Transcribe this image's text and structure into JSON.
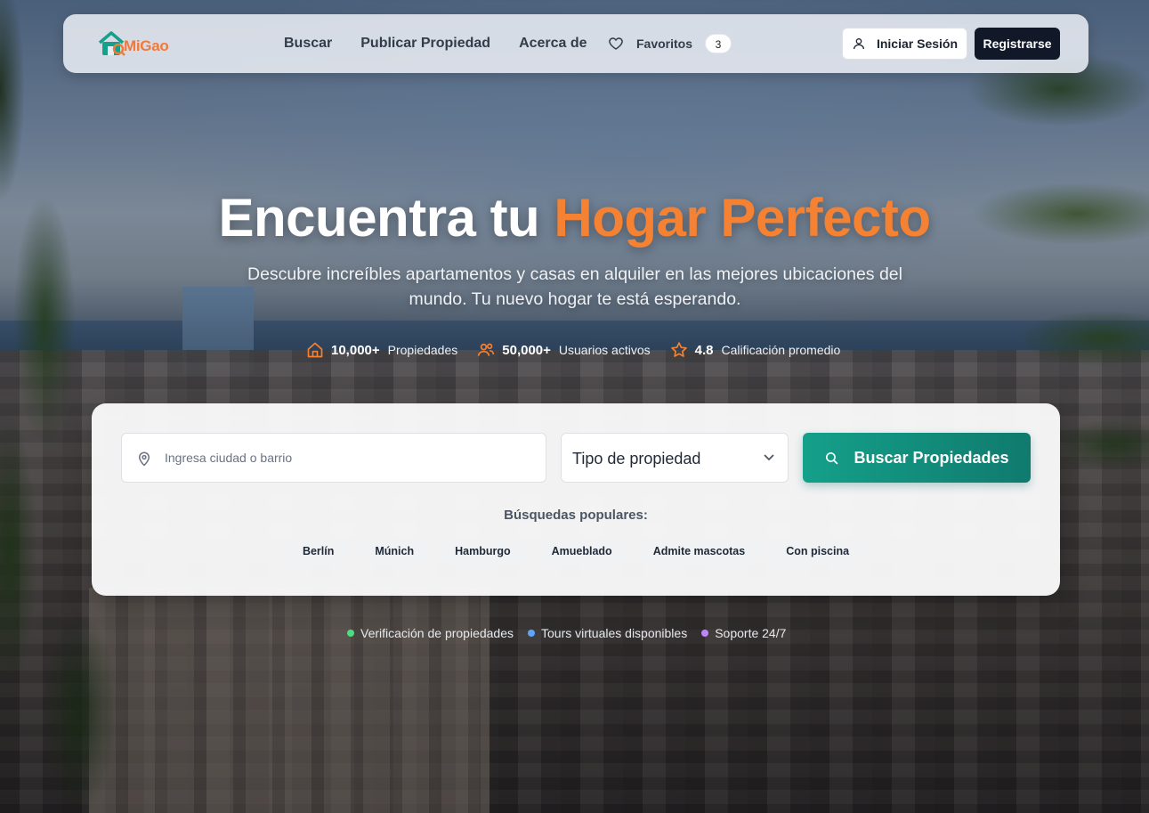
{
  "brand": {
    "name": "MiGao",
    "accent_color": "#f07a3c",
    "teal": "#14a08a"
  },
  "nav": {
    "links": [
      "Buscar",
      "Publicar Propiedad",
      "Acerca de"
    ],
    "favorites_label": "Favoritos",
    "favorites_count": "3",
    "login_label": "Iniciar Sesión",
    "register_label": "Registrarse"
  },
  "hero": {
    "title_plain": "Encuentra tu",
    "title_accent": "Hogar Perfecto",
    "subtitle": "Descubre increíbles apartamentos y casas en alquiler en las mejores ubicaciones del mundo. Tu nuevo hogar te está esperando.",
    "stats": [
      {
        "icon": "home-icon",
        "value": "10,000+",
        "label": "Propiedades"
      },
      {
        "icon": "users-icon",
        "value": "50,000+",
        "label": "Usuarios activos"
      },
      {
        "icon": "star-icon",
        "value": "4.8",
        "label": "Calificación promedio"
      }
    ]
  },
  "search": {
    "location_placeholder": "Ingresa ciudad o barrio",
    "location_value": "",
    "property_type_selected": "Tipo de propiedad",
    "button_label": "Buscar Propiedades",
    "popular_title": "Búsquedas populares:",
    "popular": [
      "Berlín",
      "Múnich",
      "Hamburgo",
      "Amueblado",
      "Admite mascotas",
      "Con piscina"
    ]
  },
  "features": [
    {
      "label": "Verificación de propiedades",
      "color": "#4ade80"
    },
    {
      "label": "Tours virtuales disponibles",
      "color": "#60a5fa"
    },
    {
      "label": "Soporte 24/7",
      "color": "#c084fc"
    }
  ]
}
